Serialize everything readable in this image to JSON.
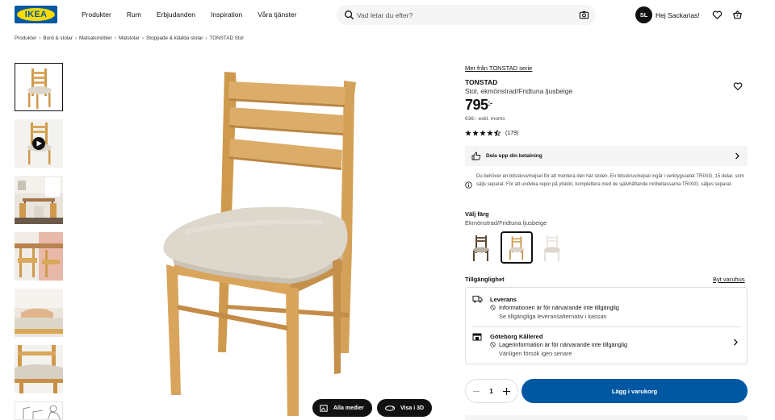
{
  "header": {
    "logo_text": "IKEA",
    "nav": [
      "Produkter",
      "Rum",
      "Erbjudanden",
      "Inspiration",
      "Våra tjänster"
    ],
    "search_placeholder": "Vad letar du efter?",
    "avatar_initials": "SL",
    "greeting": "Hej Sackarias!"
  },
  "breadcrumb": [
    "Produkter",
    "Bord & stolar",
    "Matsalsmöbler",
    "Matstolar",
    "Stoppade & klädda stolar",
    "TONSTAD Stol"
  ],
  "gallery": {
    "thumbnails": [
      "chair-front",
      "chair-video",
      "dining-room",
      "chairs-at-table",
      "seated-person",
      "seat-detail",
      "assembly-drawing"
    ],
    "all_media_label": "Alla medier",
    "view_3d_label": "Visa i 3D"
  },
  "product": {
    "series_link": "Mer från TONSTAD serie",
    "name": "TONSTAD",
    "description": "Stol, ekmönstrad/Fridtuna ljusbeige",
    "price": "795",
    "price_suffix": ":-",
    "price_ex_vat": "636:- exkl. moms",
    "rating": 4.5,
    "review_count": "(179)"
  },
  "payment": {
    "label": "Dela upp din betalning"
  },
  "assembly_note": "Du behöver en bitsskruvmejsel för att montera den här stolen. En bitsskruvmejsel ingår i verktygssetet TRIXIG, 15 delar, som säljs separat. För att undvika repor på ytskikt, komplettera med de självhäftande möbeltassarna TRIXIG, säljes separat.",
  "color": {
    "label": "Välj färg",
    "selected": "Ekmönstrad/Fridtuna ljusbeige",
    "options": [
      "dark-brown",
      "oak-beige",
      "white-beige"
    ],
    "selected_index": 1
  },
  "availability": {
    "label": "Tillgänglighet",
    "change_store": "Byt varuhus",
    "delivery": {
      "title": "Leverans",
      "status": "Informationen är för närvarande inte tillgänglig",
      "sub": "Se tillgängliga leveransalternativ i kassan"
    },
    "store": {
      "title": "Göteborg Kållered",
      "status": "Lagerinformation är för närvarande inte tillgänglig",
      "sub": "Vänligen försök igen senare"
    }
  },
  "cart": {
    "quantity": "1",
    "add_label": "Lägg i varukorg"
  },
  "colors": {
    "accent": "#0058a3",
    "logo_yellow": "#ffdb00",
    "wood": "#d9a85b",
    "fabric": "#ddd7cc"
  }
}
